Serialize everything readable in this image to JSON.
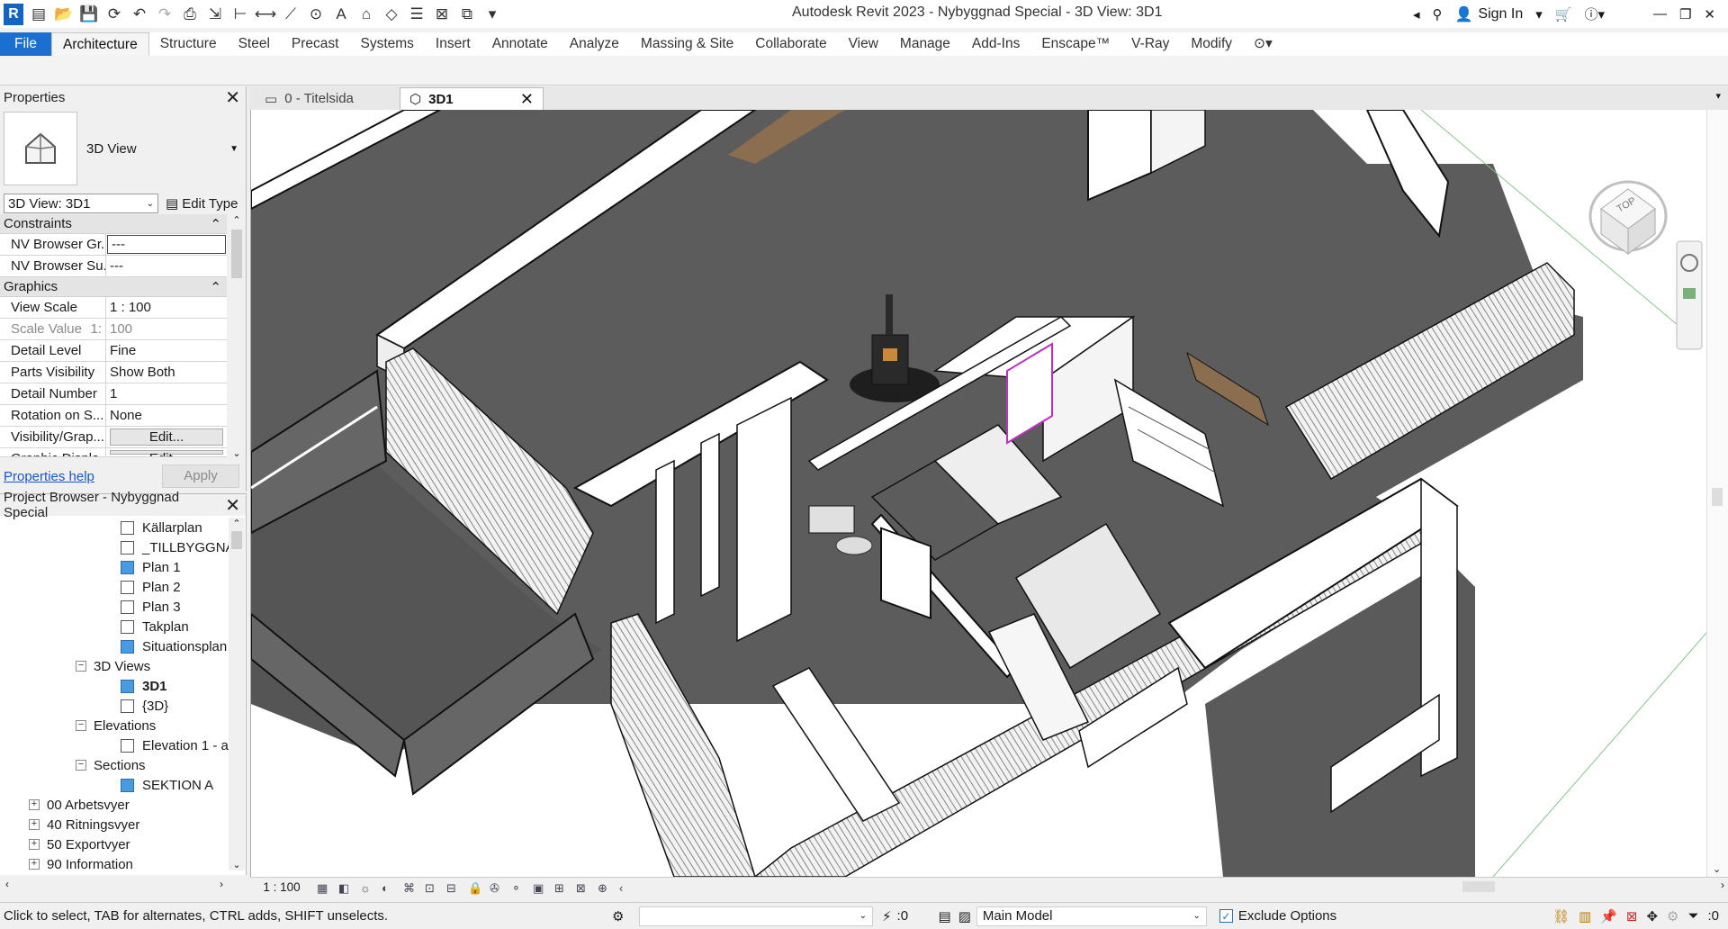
{
  "app": {
    "title": "Autodesk Revit 2023 - Nybyggnad Special - 3D View: 3D1",
    "logo_letter": "R",
    "sign_in": "Sign In"
  },
  "ribbon": {
    "tabs": [
      "File",
      "Architecture",
      "Structure",
      "Steel",
      "Precast",
      "Systems",
      "Insert",
      "Annotate",
      "Analyze",
      "Massing & Site",
      "Collaborate",
      "View",
      "Manage",
      "Add-Ins",
      "Enscape™",
      "V-Ray",
      "Modify"
    ],
    "active_index": 1
  },
  "properties": {
    "title": "Properties",
    "type_name": "3D View",
    "view_selector": "3D View: 3D1",
    "edit_type": "Edit Type",
    "sections": {
      "constraints": "Constraints",
      "graphics": "Graphics"
    },
    "rows": {
      "nv_browser_gr": {
        "key": "NV Browser Gr...",
        "value": "---"
      },
      "nv_browser_su": {
        "key": "NV Browser Su...",
        "value": "---"
      },
      "view_scale": {
        "key": "View Scale",
        "value": "1 : 100"
      },
      "scale_value": {
        "key": "Scale Value",
        "prefix": "1:",
        "value": "100"
      },
      "detail_level": {
        "key": "Detail Level",
        "value": "Fine"
      },
      "parts_visibility": {
        "key": "Parts Visibility",
        "value": "Show Both"
      },
      "detail_number": {
        "key": "Detail Number",
        "value": "1"
      },
      "rotation": {
        "key": "Rotation on S...",
        "value": "None"
      },
      "visibility": {
        "key": "Visibility/Grap...",
        "value": "Edit..."
      },
      "graphic_display": {
        "key": "Graphic Displa...",
        "value": "Edit..."
      }
    },
    "help_link": "Properties help",
    "apply": "Apply"
  },
  "browser": {
    "title": "Project Browser - Nybyggnad Special",
    "items": {
      "kallarplan": "Källarplan",
      "tillbyggnad": "_TILLBYGGNAD",
      "plan1": "Plan 1",
      "plan2": "Plan 2",
      "plan3": "Plan 3",
      "takplan": "Takplan",
      "situationsplan": "Situationsplan",
      "views3d": "3D Views",
      "view3d1": "3D1",
      "view3d": "{3D}",
      "elevations": "Elevations",
      "elevation1": "Elevation 1 - a",
      "sections": "Sections",
      "sektion_a": "SEKTION A",
      "arbetsvyer": "00 Arbetsvyer",
      "ritningsvyer": "40 Ritningsvyer",
      "exportvyer": "50 Exportvyer",
      "information": "90 Information"
    }
  },
  "view_tabs": {
    "tab1": "0 - Titelsida",
    "tab2": "3D1"
  },
  "viewcube": {
    "label": "TOP"
  },
  "viewbar": {
    "scale": "1 : 100"
  },
  "status": {
    "hint": "Click to select, TAB for alternates, CTRL adds, SHIFT unselects.",
    "count": ":0",
    "model": "Main Model",
    "exclude_options": "Exclude Options",
    "filter_count": ":0"
  }
}
